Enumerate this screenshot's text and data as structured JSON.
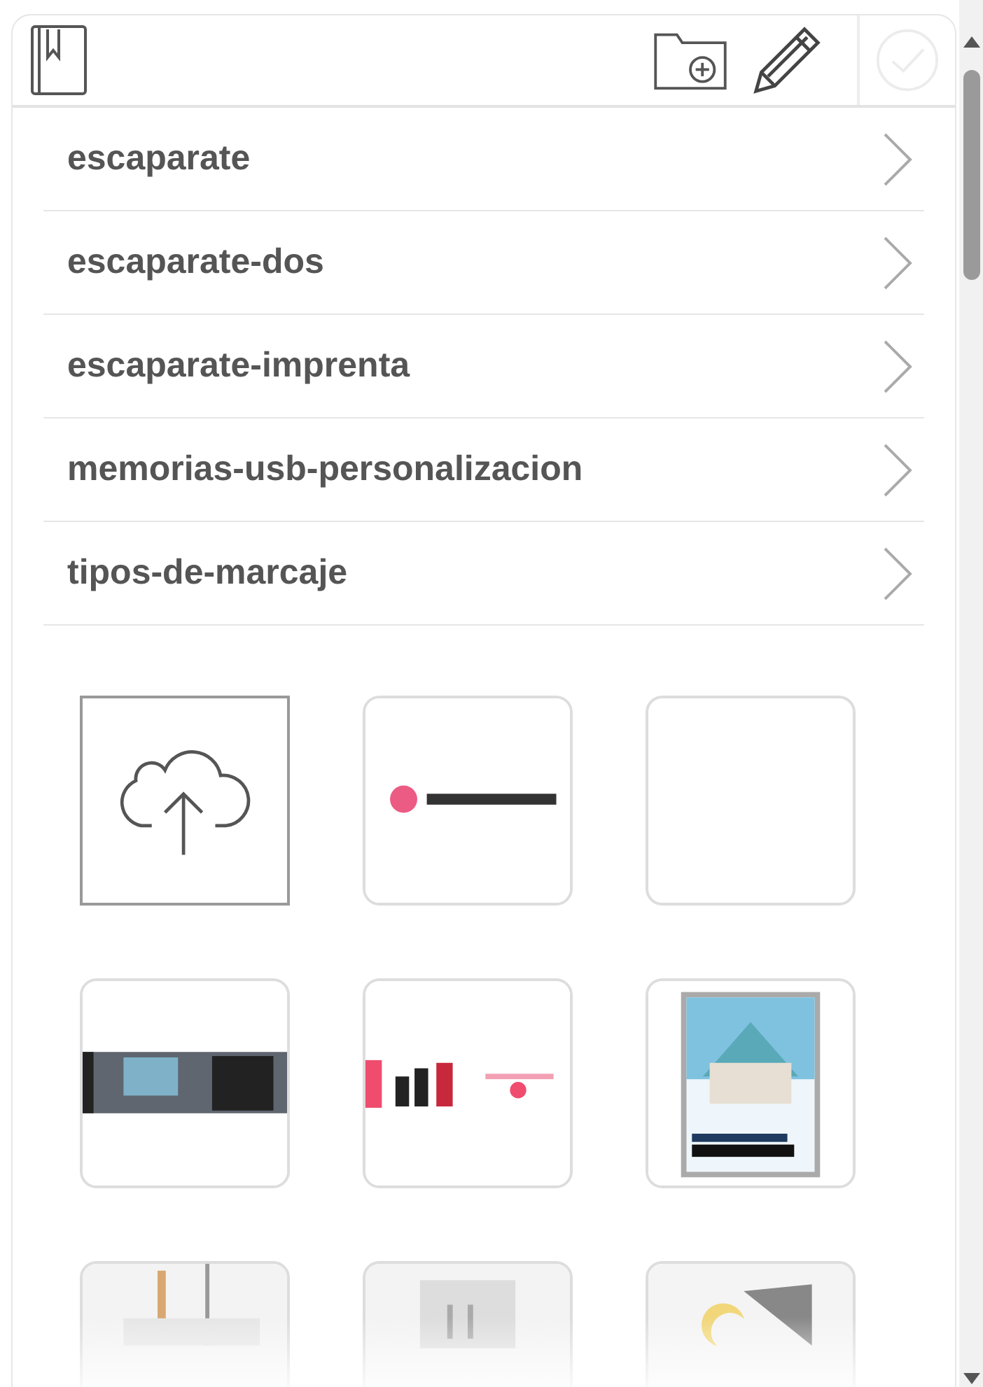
{
  "toolbar": {
    "confirm": {
      "disabled": true
    }
  },
  "folders": [
    {
      "name": "escaparate"
    },
    {
      "name": "escaparate-dos"
    },
    {
      "name": "escaparate-imprenta"
    },
    {
      "name": "memorias-usb-personalizacion"
    },
    {
      "name": "tipos-de-marcaje"
    }
  ],
  "tiles": [
    {
      "kind": "upload"
    },
    {
      "kind": "picture"
    },
    {
      "kind": "empty"
    },
    {
      "kind": "picture"
    },
    {
      "kind": "picture"
    },
    {
      "kind": "picture"
    },
    {
      "kind": "picture"
    },
    {
      "kind": "picture"
    },
    {
      "kind": "picture"
    }
  ]
}
